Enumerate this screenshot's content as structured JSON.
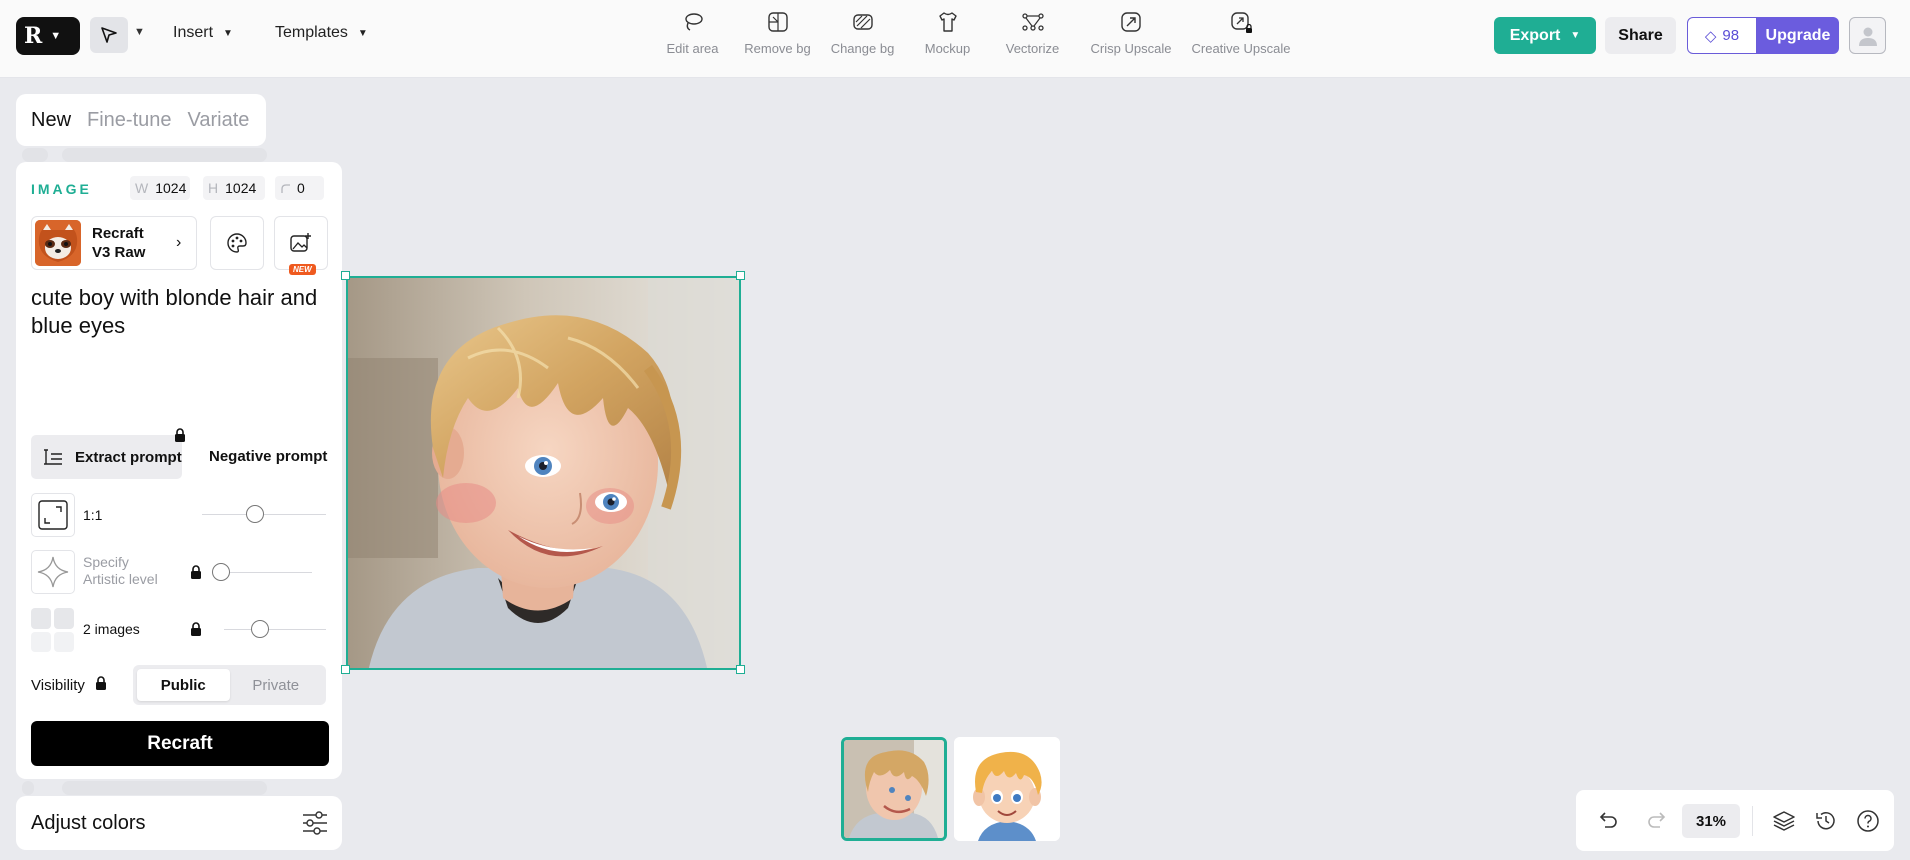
{
  "topbar": {
    "insert_label": "Insert",
    "templates_label": "Templates",
    "tools": [
      {
        "label": "Edit area",
        "icon": "lasso-icon"
      },
      {
        "label": "Remove bg",
        "icon": "remove-bg-icon"
      },
      {
        "label": "Change bg",
        "icon": "change-bg-icon"
      },
      {
        "label": "Mockup",
        "icon": "tshirt-icon"
      },
      {
        "label": "Vectorize",
        "icon": "vector-nodes-icon"
      },
      {
        "label": "Crisp Upscale",
        "icon": "upscale-icon"
      },
      {
        "label": "Creative Upscale",
        "icon": "creative-upscale-icon"
      }
    ],
    "export_label": "Export",
    "share_label": "Share",
    "credits": "98",
    "upgrade_label": "Upgrade"
  },
  "mode_tabs": [
    "New",
    "Fine-tune",
    "Variate"
  ],
  "panel": {
    "section_label": "IMAGE",
    "width_key": "W",
    "width": "1024",
    "height_key": "H",
    "height": "1024",
    "corner_radius": "0",
    "model_name": "Recraft V3 Raw",
    "new_badge": "NEW",
    "prompt": "cute boy with blonde hair and blue eyes",
    "extract_label": "Extract prompt",
    "negative_label": "Negative prompt",
    "aspect_label": "1:1",
    "artistic_label": "Specify Artistic level",
    "images_label": "2 images",
    "visibility_label": "Visibility",
    "visibility_options": [
      "Public",
      "Private"
    ],
    "generate_label": "Recraft"
  },
  "adjust_label": "Adjust colors",
  "zoom": "31%",
  "colors": {
    "accent": "#1fae94",
    "upgrade": "#6b5cde",
    "canvas_bg": "#e9eaee"
  }
}
